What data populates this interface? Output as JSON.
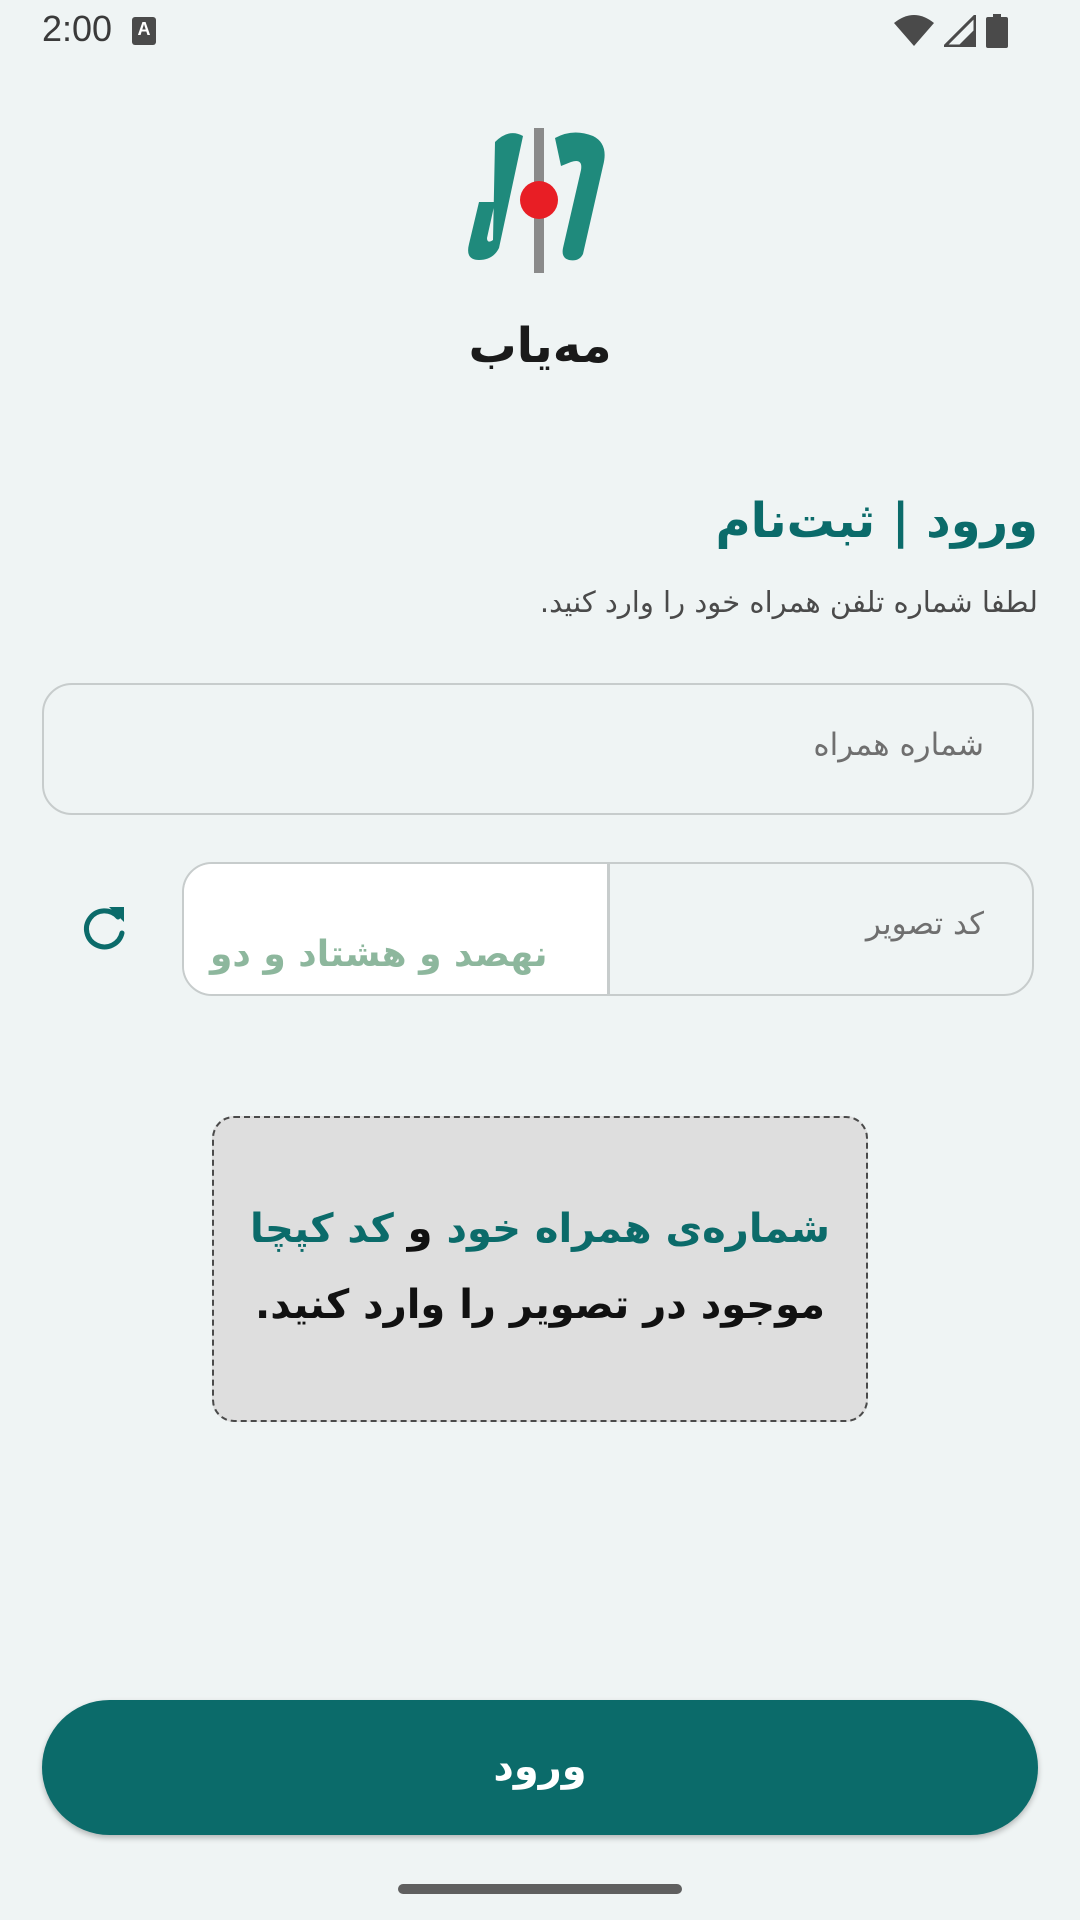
{
  "status_bar": {
    "time": "2:00",
    "notification_icon_letter": "A",
    "icons": [
      "wifi-icon",
      "signal-icon",
      "battery-icon"
    ]
  },
  "app": {
    "name": "مه‌یاب",
    "logo_icon": "mahyab-logo-icon"
  },
  "login": {
    "title": "ورود | ثبت‌نام",
    "subtitle": "لطفا شماره تلفن همراه خود را وارد کنید."
  },
  "phone_field": {
    "placeholder": "شماره همراه",
    "value": ""
  },
  "captcha": {
    "placeholder": "کد تصویر",
    "value": "",
    "image_text": "نهصد و هشتاد و دو",
    "refresh_icon": "refresh-icon"
  },
  "hint": {
    "part1_accent": "شماره‌ی همراه خود",
    "part1_join": " و ",
    "part1_accent2": "کد کپچا",
    "line2": "موجود در تصویر را وارد کنید."
  },
  "submit": {
    "label": "ورود"
  },
  "colors": {
    "background": "#eff4f4",
    "accent": "#0b6b6a",
    "logo_red": "#e81e25",
    "hint_background": "#dedede"
  }
}
